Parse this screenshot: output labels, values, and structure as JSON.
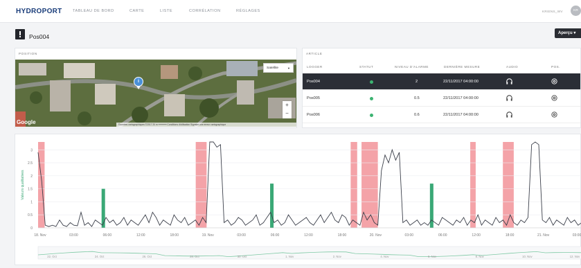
{
  "brand": "HYDROPORT",
  "nav": [
    {
      "label": "TABLEAU DE BORD"
    },
    {
      "label": "CARTE"
    },
    {
      "label": "LISTE"
    },
    {
      "label": "CORRÉLATION"
    },
    {
      "label": "RÉGLAGES"
    }
  ],
  "user": {
    "name": "KRIENS_WV",
    "initials": "KR"
  },
  "page": {
    "title": "Pos004",
    "apercu": "Aperçu ▾"
  },
  "position": {
    "header": "POSITION",
    "map_type": "Satellite",
    "google": "Google",
    "footer": "Données cartographiques ©2017   20 m  ━━━━━━   Conditions d'utilisation   Signaler une erreur cartographique"
  },
  "article": {
    "header": "ARTICLE",
    "columns": [
      "LOGGER",
      "STATUT",
      "NIVEAU D'ALARME",
      "DERNIÈRE MESURE",
      "AUDIO",
      "POS."
    ],
    "rows": [
      {
        "logger": "Pos004",
        "alarm": "2",
        "last": "22/11/2017 04:00:00",
        "selected": true
      },
      {
        "logger": "Pos005",
        "alarm": "0.5",
        "last": "22/11/2017 04:00:00",
        "selected": false
      },
      {
        "logger": "Pos006",
        "alarm": "0.6",
        "last": "22/11/2017 04:00:00",
        "selected": false
      }
    ]
  },
  "chart_data": {
    "type": "line",
    "ylabel": "Valeurs qualitatives",
    "y_ticks": [
      "0",
      "0.5",
      "1",
      "1.5",
      "2",
      "2.5",
      "3"
    ],
    "ylim": [
      0,
      3.3
    ],
    "x_ticks": [
      "18. Nov",
      "03:00",
      "06:00",
      "12:00",
      "18:00",
      "19. Nov",
      "03:00",
      "06:00",
      "12:00",
      "18:00",
      "20. Nov",
      "03:00",
      "06:00",
      "12:00",
      "18:00",
      "21. Nov",
      "03:00"
    ],
    "alarm_bands_color": "#f4a3a8",
    "marker_color": "#3aa876",
    "series": [
      {
        "values": [
          2.9,
          1.8,
          0.1,
          0.05,
          0.1,
          0.05,
          0.3,
          0.1,
          0.05,
          0.2,
          0.1,
          0.08,
          0.6,
          0.1,
          0.2,
          0.05,
          0.3,
          0.2,
          0.1,
          0.4,
          0.2,
          0.3,
          0.1,
          0.2,
          0.4,
          0.1,
          0.3,
          0.2,
          0.1,
          0.3,
          0.5,
          0.2,
          0.6,
          0.4,
          0.1,
          0.3,
          0.2,
          0.1,
          0.5,
          0.3,
          0.2,
          0.4,
          0.1,
          0.2,
          0.3,
          0.1,
          0.4,
          0.2,
          3.3,
          3.3,
          3.1,
          3.2,
          0.2,
          0.3,
          0.1,
          0.2,
          0.4,
          0.3,
          0.1,
          0.2,
          0.3,
          0.5,
          0.1,
          0.2,
          0.4,
          0.6,
          0.2,
          0.3,
          0.1,
          0.2,
          0.5,
          0.3,
          0.1,
          0.2,
          0.3,
          0.4,
          0.2,
          0.1,
          0.3,
          0.5,
          0.2,
          0.4,
          0.6,
          0.3,
          0.2,
          0.5,
          0.4,
          0.1,
          0.3,
          0.2,
          0.1,
          0.6,
          0.3,
          0.5,
          0.2,
          0.1,
          2.2,
          2.8,
          2.5,
          3.0,
          2.6,
          2.9,
          0.2,
          0.3,
          0.1,
          0.2,
          0.3,
          0.1,
          0.2,
          0.1,
          0.3,
          0.2,
          0.1,
          0.4,
          0.3,
          0.2,
          0.1,
          0.3,
          0.2,
          0.4,
          0.1,
          0.3,
          0.2,
          0.5,
          0.1,
          0.3,
          0.2,
          0.1,
          0.4,
          0.2,
          0.3,
          0.1,
          0.5,
          0.2,
          0.1,
          0.3,
          0.2,
          0.4,
          3.2,
          3.3,
          3.2,
          0.3,
          0.2,
          0.4,
          0.1,
          0.3,
          0.2,
          0.1,
          0.4,
          0.2,
          0.3,
          0.1,
          0.2
        ]
      },
      {
        "name": "alarm_bands",
        "values": [
          [
            0,
            0.012
          ],
          [
            0.29,
            0.31
          ],
          [
            0.575,
            0.587
          ],
          [
            0.595,
            0.625
          ],
          [
            0.795,
            0.805
          ],
          [
            0.855,
            0.875
          ]
        ]
      },
      {
        "name": "markers",
        "values": [
          [
            0.12,
            1.5
          ],
          [
            0.43,
            1.7
          ],
          [
            0.724,
            1.7
          ]
        ]
      }
    ]
  },
  "timeline": {
    "labels": [
      "22. Oct",
      "24. Oct",
      "26. Oct",
      "28. Oct",
      "30. Oct",
      "1. Nov",
      "2. Nov",
      "4. Nov",
      "6. Nov",
      "8. Nov",
      "10. Nov",
      "12. Nov"
    ]
  }
}
